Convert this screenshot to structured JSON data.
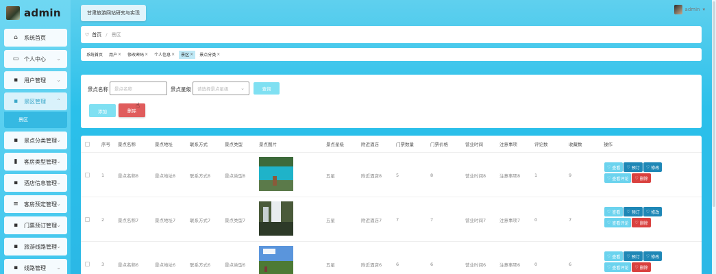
{
  "app": {
    "title": "admin",
    "system_name": "甘肃旅游网站研究与实现",
    "user": "admin"
  },
  "sidebar": {
    "items": [
      {
        "label": "系统首页",
        "icon": "home-icon"
      },
      {
        "label": "个人中心",
        "icon": "calendar-icon"
      },
      {
        "label": "用户管理",
        "icon": "grid-icon"
      },
      {
        "label": "景区管理",
        "icon": "grid-icon",
        "sub": "景区"
      },
      {
        "label": "景点分类管理",
        "icon": "grid-icon"
      },
      {
        "label": "客房类型管理",
        "icon": "bar-chart-icon"
      },
      {
        "label": "酒店信息管理",
        "icon": "grid-icon"
      },
      {
        "label": "客房预定管理",
        "icon": "list-icon"
      },
      {
        "label": "门票预订管理",
        "icon": "grid-icon"
      },
      {
        "label": "旅游线路管理",
        "icon": "grid-icon"
      },
      {
        "label": "线路管理",
        "icon": "grid-icon"
      }
    ]
  },
  "breadcrumb": {
    "home": "首页",
    "current": "景区"
  },
  "tabs": [
    {
      "label": "系统首页",
      "closable": false
    },
    {
      "label": "用户",
      "closable": true
    },
    {
      "label": "修改密码",
      "closable": true
    },
    {
      "label": "个人信息",
      "closable": true
    },
    {
      "label": "景区",
      "closable": true,
      "active": true
    },
    {
      "label": "景点分类",
      "closable": true
    }
  ],
  "search": {
    "name_label": "景点名称",
    "name_placeholder": "景点名称",
    "level_label": "景点星级",
    "level_placeholder": "请选择景点星级",
    "search_button": "查询",
    "add_button": "添加",
    "delete_button": "删除"
  },
  "table": {
    "headers": [
      "序号",
      "景点名称",
      "景点地址",
      "联系方式",
      "景点类型",
      "景点图片",
      "景点星级",
      "附近酒店",
      "门票数量",
      "门票价格",
      "营业时间",
      "注意事项",
      "评论数",
      "收藏数",
      "操作"
    ],
    "rows": [
      {
        "idx": "1",
        "name": "景点名称8",
        "addr": "景点地址8",
        "contact": "联系方式8",
        "type": "景点类型8",
        "star": "五星",
        "hotel": "附近酒店8",
        "qty": "5",
        "price": "8",
        "hours": "营业时间8",
        "note": "注意事项8",
        "comments": "1",
        "favs": "9"
      },
      {
        "idx": "2",
        "name": "景点名称7",
        "addr": "景点地址7",
        "contact": "联系方式7",
        "type": "景点类型7",
        "star": "五星",
        "hotel": "附近酒店7",
        "qty": "7",
        "price": "7",
        "hours": "营业时间7",
        "note": "注意事项7",
        "comments": "0",
        "favs": "7"
      },
      {
        "idx": "3",
        "name": "景点名称6",
        "addr": "景点地址6",
        "contact": "联系方式6",
        "type": "景点类型6",
        "star": "五星",
        "hotel": "附近酒店6",
        "qty": "6",
        "price": "6",
        "hours": "营业时间6",
        "note": "注意事项6",
        "comments": "0",
        "favs": "6"
      }
    ],
    "ops": {
      "view": "查看",
      "book": "预订",
      "edit": "修改",
      "comments": "查看评论",
      "delete": "删除"
    }
  }
}
